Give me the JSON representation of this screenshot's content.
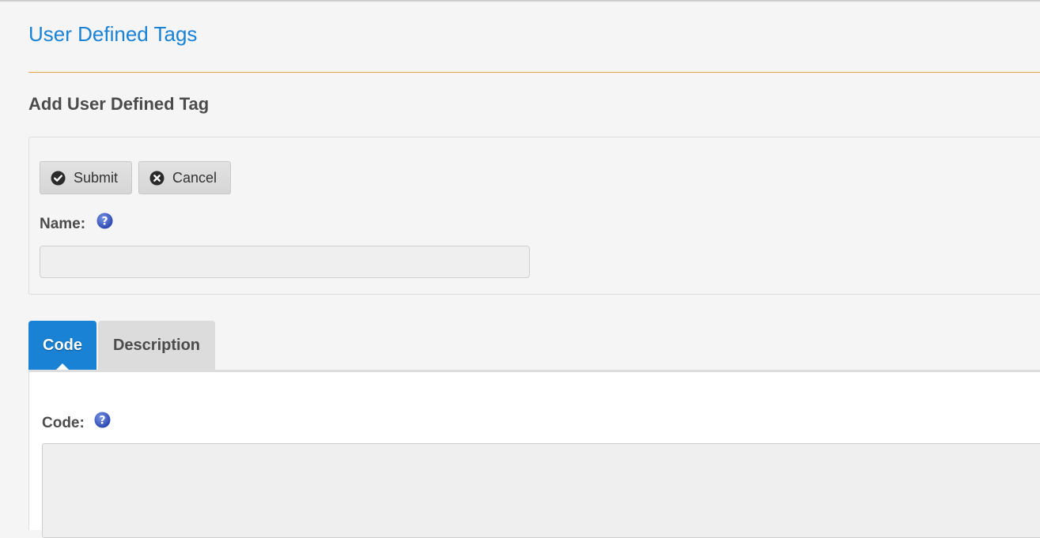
{
  "page": {
    "title": "User Defined Tags",
    "section_heading": "Add User Defined Tag"
  },
  "toolbar": {
    "submit_label": "Submit",
    "submit_icon": "check-circle-icon",
    "cancel_label": "Cancel",
    "cancel_icon": "x-circle-icon"
  },
  "form": {
    "name_label": "Name:",
    "name_value": "",
    "name_placeholder": "",
    "help_icon": "question-mark-icon"
  },
  "tabs": [
    {
      "label": "Code",
      "active": true
    },
    {
      "label": "Description",
      "active": false
    }
  ],
  "code_panel": {
    "code_label": "Code:",
    "code_value": ""
  },
  "colors": {
    "accent": "#1a82d4",
    "rule": "#e3a045",
    "help_icon": "#3b5bbf"
  }
}
